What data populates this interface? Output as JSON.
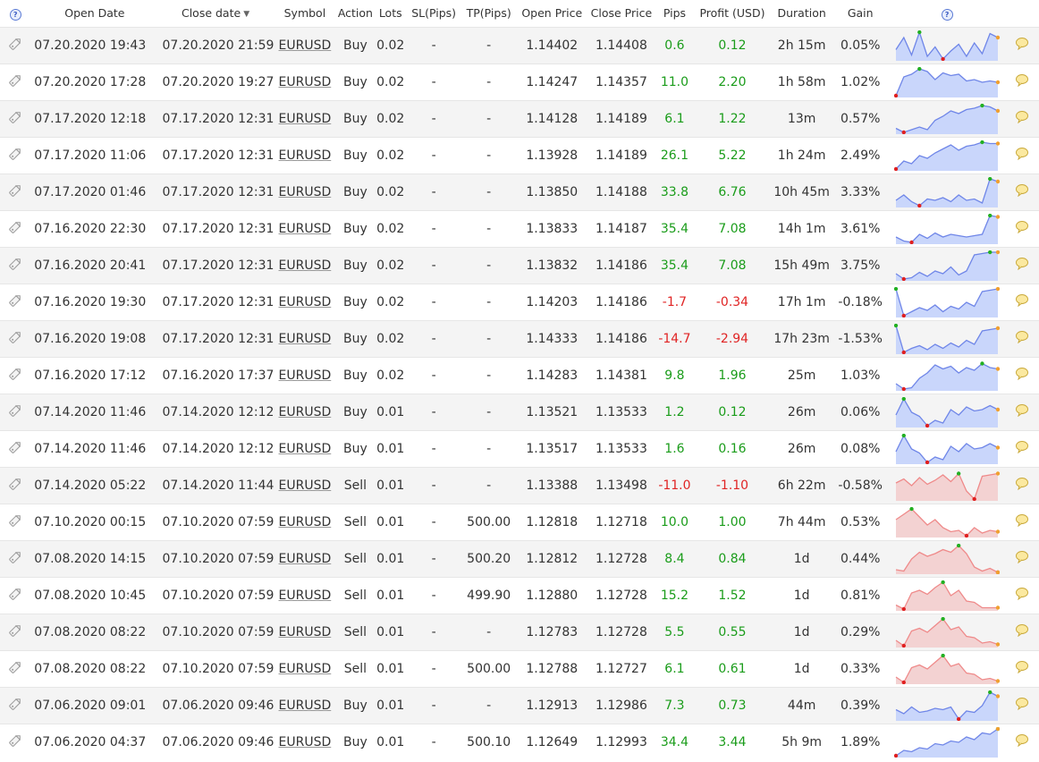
{
  "headers": {
    "open_date": "Open Date",
    "close_date": "Close date",
    "symbol": "Symbol",
    "action": "Action",
    "lots": "Lots",
    "sl": "SL(Pips)",
    "tp": "TP(Pips)",
    "open_price": "Open Price",
    "close_price": "Close Price",
    "pips": "Pips",
    "profit": "Profit (USD)",
    "duration": "Duration",
    "gain": "Gain",
    "help_glyph": "?"
  },
  "colors": {
    "positive": "#1a9c1a",
    "negative": "#e02424",
    "buy_fill": "#c9d6fb",
    "buy_line": "#6f86e8",
    "sell_fill": "#f3d2d2",
    "sell_line": "#ef8a8a"
  },
  "rows": [
    {
      "open": "07.20.2020 19:43",
      "close": "07.20.2020 21:59",
      "symbol": "EURUSD",
      "action": "Buy",
      "lots": "0.02",
      "sl": "-",
      "tp": "-",
      "open_price": "1.14402",
      "close_price": "1.14408",
      "pips": "0.6",
      "profit": "0.12",
      "duration": "2h 15m",
      "gain": "0.05%",
      "sign": "pos",
      "spark": [
        0.35,
        0.8,
        0.15,
        1.0,
        0.1,
        0.45,
        0.0,
        0.3,
        0.55,
        0.1,
        0.6,
        0.2,
        0.95,
        0.8
      ]
    },
    {
      "open": "07.20.2020 17:28",
      "close": "07.20.2020 19:27",
      "symbol": "EURUSD",
      "action": "Buy",
      "lots": "0.02",
      "sl": "-",
      "tp": "-",
      "open_price": "1.14247",
      "close_price": "1.14357",
      "pips": "11.0",
      "profit": "2.20",
      "duration": "1h 58m",
      "gain": "1.02%",
      "sign": "pos",
      "spark": [
        0.0,
        0.7,
        0.8,
        1.0,
        0.9,
        0.6,
        0.85,
        0.75,
        0.8,
        0.55,
        0.6,
        0.5,
        0.55,
        0.5
      ]
    },
    {
      "open": "07.17.2020 12:18",
      "close": "07.17.2020 12:31",
      "symbol": "EURUSD",
      "action": "Buy",
      "lots": "0.02",
      "sl": "-",
      "tp": "-",
      "open_price": "1.14128",
      "close_price": "1.14189",
      "pips": "6.1",
      "profit": "1.22",
      "duration": "13m",
      "gain": "0.57%",
      "sign": "pos",
      "spark": [
        0.15,
        0.0,
        0.1,
        0.2,
        0.1,
        0.45,
        0.6,
        0.8,
        0.7,
        0.85,
        0.9,
        1.0,
        0.95,
        0.8
      ]
    },
    {
      "open": "07.17.2020 11:06",
      "close": "07.17.2020 12:31",
      "symbol": "EURUSD",
      "action": "Buy",
      "lots": "0.02",
      "sl": "-",
      "tp": "-",
      "open_price": "1.13928",
      "close_price": "1.14189",
      "pips": "26.1",
      "profit": "5.22",
      "duration": "1h 24m",
      "gain": "2.49%",
      "sign": "pos",
      "spark": [
        0.0,
        0.3,
        0.2,
        0.5,
        0.4,
        0.6,
        0.75,
        0.9,
        0.7,
        0.85,
        0.9,
        1.0,
        0.95,
        0.95
      ]
    },
    {
      "open": "07.17.2020 01:46",
      "close": "07.17.2020 12:31",
      "symbol": "EURUSD",
      "action": "Buy",
      "lots": "0.02",
      "sl": "-",
      "tp": "-",
      "open_price": "1.13850",
      "close_price": "1.14188",
      "pips": "33.8",
      "profit": "6.76",
      "duration": "10h 45m",
      "gain": "3.33%",
      "sign": "pos",
      "spark": [
        0.2,
        0.4,
        0.15,
        0.0,
        0.25,
        0.2,
        0.3,
        0.15,
        0.4,
        0.2,
        0.25,
        0.1,
        1.0,
        0.9
      ]
    },
    {
      "open": "07.16.2020 22:30",
      "close": "07.17.2020 12:31",
      "symbol": "EURUSD",
      "action": "Buy",
      "lots": "0.02",
      "sl": "-",
      "tp": "-",
      "open_price": "1.13833",
      "close_price": "1.14187",
      "pips": "35.4",
      "profit": "7.08",
      "duration": "14h 1m",
      "gain": "3.61%",
      "sign": "pos",
      "spark": [
        0.2,
        0.05,
        0.0,
        0.3,
        0.15,
        0.35,
        0.2,
        0.3,
        0.25,
        0.2,
        0.25,
        0.3,
        1.0,
        0.95
      ]
    },
    {
      "open": "07.16.2020 20:41",
      "close": "07.17.2020 12:31",
      "symbol": "EURUSD",
      "action": "Buy",
      "lots": "0.02",
      "sl": "-",
      "tp": "-",
      "open_price": "1.13832",
      "close_price": "1.14186",
      "pips": "35.4",
      "profit": "7.08",
      "duration": "15h 49m",
      "gain": "3.75%",
      "sign": "pos",
      "spark": [
        0.2,
        0.0,
        0.05,
        0.25,
        0.1,
        0.3,
        0.2,
        0.45,
        0.15,
        0.3,
        0.9,
        0.95,
        1.0,
        1.0
      ]
    },
    {
      "open": "07.16.2020 19:30",
      "close": "07.17.2020 12:31",
      "symbol": "EURUSD",
      "action": "Buy",
      "lots": "0.02",
      "sl": "-",
      "tp": "-",
      "open_price": "1.14203",
      "close_price": "1.14186",
      "pips": "-1.7",
      "profit": "-0.34",
      "duration": "17h 1m",
      "gain": "-0.18%",
      "sign": "neg",
      "spark": [
        1.0,
        0.0,
        0.15,
        0.3,
        0.2,
        0.4,
        0.15,
        0.35,
        0.25,
        0.5,
        0.35,
        0.9,
        0.95,
        1.0
      ]
    },
    {
      "open": "07.16.2020 19:08",
      "close": "07.17.2020 12:31",
      "symbol": "EURUSD",
      "action": "Buy",
      "lots": "0.02",
      "sl": "-",
      "tp": "-",
      "open_price": "1.14333",
      "close_price": "1.14186",
      "pips": "-14.7",
      "profit": "-2.94",
      "duration": "17h 23m",
      "gain": "-1.53%",
      "sign": "neg",
      "spark": [
        1.0,
        0.0,
        0.15,
        0.25,
        0.1,
        0.3,
        0.15,
        0.35,
        0.2,
        0.45,
        0.3,
        0.8,
        0.85,
        0.9
      ]
    },
    {
      "open": "07.16.2020 17:12",
      "close": "07.16.2020 17:37",
      "symbol": "EURUSD",
      "action": "Buy",
      "lots": "0.02",
      "sl": "-",
      "tp": "-",
      "open_price": "1.14283",
      "close_price": "1.14381",
      "pips": "9.8",
      "profit": "1.96",
      "duration": "25m",
      "gain": "1.03%",
      "sign": "pos",
      "spark": [
        0.2,
        0.0,
        0.05,
        0.4,
        0.6,
        0.9,
        0.75,
        0.85,
        0.6,
        0.8,
        0.7,
        0.95,
        0.8,
        0.75
      ]
    },
    {
      "open": "07.14.2020 11:46",
      "close": "07.14.2020 12:12",
      "symbol": "EURUSD",
      "action": "Buy",
      "lots": "0.01",
      "sl": "-",
      "tp": "-",
      "open_price": "1.13521",
      "close_price": "1.13533",
      "pips": "1.2",
      "profit": "0.12",
      "duration": "26m",
      "gain": "0.06%",
      "sign": "pos",
      "spark": [
        0.4,
        1.0,
        0.5,
        0.35,
        0.0,
        0.2,
        0.1,
        0.6,
        0.4,
        0.7,
        0.55,
        0.6,
        0.75,
        0.6
      ]
    },
    {
      "open": "07.14.2020 11:46",
      "close": "07.14.2020 12:12",
      "symbol": "EURUSD",
      "action": "Buy",
      "lots": "0.01",
      "sl": "-",
      "tp": "-",
      "open_price": "1.13517",
      "close_price": "1.13533",
      "pips": "1.6",
      "profit": "0.16",
      "duration": "26m",
      "gain": "0.08%",
      "sign": "pos",
      "spark": [
        0.4,
        1.0,
        0.5,
        0.35,
        0.0,
        0.2,
        0.1,
        0.6,
        0.4,
        0.7,
        0.5,
        0.55,
        0.7,
        0.55
      ]
    },
    {
      "open": "07.14.2020 05:22",
      "close": "07.14.2020 11:44",
      "symbol": "EURUSD",
      "action": "Sell",
      "lots": "0.01",
      "sl": "-",
      "tp": "-",
      "open_price": "1.13388",
      "close_price": "1.13498",
      "pips": "-11.0",
      "profit": "-1.10",
      "duration": "6h 22m",
      "gain": "-0.58%",
      "sign": "neg",
      "spark": [
        0.6,
        0.75,
        0.5,
        0.8,
        0.55,
        0.7,
        0.9,
        0.65,
        0.95,
        0.3,
        0.0,
        0.85,
        0.9,
        0.95
      ]
    },
    {
      "open": "07.10.2020 00:15",
      "close": "07.10.2020 07:59",
      "symbol": "EURUSD",
      "action": "Sell",
      "lots": "0.01",
      "sl": "-",
      "tp": "500.00",
      "open_price": "1.12818",
      "close_price": "1.12718",
      "pips": "10.0",
      "profit": "1.00",
      "duration": "7h 44m",
      "gain": "0.53%",
      "sign": "pos",
      "spark": [
        0.6,
        0.8,
        1.0,
        0.7,
        0.4,
        0.6,
        0.3,
        0.15,
        0.2,
        0.0,
        0.3,
        0.1,
        0.2,
        0.15
      ]
    },
    {
      "open": "07.08.2020 14:15",
      "close": "07.10.2020 07:59",
      "symbol": "EURUSD",
      "action": "Sell",
      "lots": "0.01",
      "sl": "-",
      "tp": "500.20",
      "open_price": "1.12812",
      "close_price": "1.12728",
      "pips": "8.4",
      "profit": "0.84",
      "duration": "1d",
      "gain": "0.44%",
      "sign": "pos",
      "spark": [
        0.1,
        0.05,
        0.5,
        0.75,
        0.6,
        0.7,
        0.85,
        0.75,
        1.0,
        0.7,
        0.2,
        0.05,
        0.15,
        0.0
      ]
    },
    {
      "open": "07.08.2020 10:45",
      "close": "07.10.2020 07:59",
      "symbol": "EURUSD",
      "action": "Sell",
      "lots": "0.01",
      "sl": "-",
      "tp": "499.90",
      "open_price": "1.12880",
      "close_price": "1.12728",
      "pips": "15.2",
      "profit": "1.52",
      "duration": "1d",
      "gain": "0.81%",
      "sign": "pos",
      "spark": [
        0.15,
        0.0,
        0.6,
        0.7,
        0.55,
        0.8,
        1.0,
        0.5,
        0.7,
        0.3,
        0.25,
        0.05,
        0.05,
        0.05
      ]
    },
    {
      "open": "07.08.2020 08:22",
      "close": "07.10.2020 07:59",
      "symbol": "EURUSD",
      "action": "Sell",
      "lots": "0.01",
      "sl": "-",
      "tp": "-",
      "open_price": "1.12783",
      "close_price": "1.12728",
      "pips": "5.5",
      "profit": "0.55",
      "duration": "1d",
      "gain": "0.29%",
      "sign": "pos",
      "spark": [
        0.2,
        0.0,
        0.55,
        0.65,
        0.5,
        0.75,
        1.0,
        0.6,
        0.7,
        0.35,
        0.3,
        0.1,
        0.15,
        0.05
      ]
    },
    {
      "open": "07.08.2020 08:22",
      "close": "07.10.2020 07:59",
      "symbol": "EURUSD",
      "action": "Sell",
      "lots": "0.01",
      "sl": "-",
      "tp": "500.00",
      "open_price": "1.12788",
      "close_price": "1.12727",
      "pips": "6.1",
      "profit": "0.61",
      "duration": "1d",
      "gain": "0.33%",
      "sign": "pos",
      "spark": [
        0.2,
        0.0,
        0.55,
        0.65,
        0.5,
        0.75,
        1.0,
        0.6,
        0.7,
        0.35,
        0.3,
        0.1,
        0.15,
        0.05
      ]
    },
    {
      "open": "07.06.2020 09:01",
      "close": "07.06.2020 09:46",
      "symbol": "EURUSD",
      "action": "Buy",
      "lots": "0.01",
      "sl": "-",
      "tp": "-",
      "open_price": "1.12913",
      "close_price": "1.12986",
      "pips": "7.3",
      "profit": "0.73",
      "duration": "44m",
      "gain": "0.39%",
      "sign": "pos",
      "spark": [
        0.35,
        0.2,
        0.45,
        0.25,
        0.3,
        0.4,
        0.35,
        0.45,
        0.0,
        0.3,
        0.25,
        0.5,
        1.0,
        0.85
      ]
    },
    {
      "open": "07.06.2020 04:37",
      "close": "07.06.2020 09:46",
      "symbol": "EURUSD",
      "action": "Buy",
      "lots": "0.01",
      "sl": "-",
      "tp": "500.10",
      "open_price": "1.12649",
      "close_price": "1.12993",
      "pips": "34.4",
      "profit": "3.44",
      "duration": "5h 9m",
      "gain": "1.89%",
      "sign": "pos",
      "spark": [
        0.0,
        0.2,
        0.15,
        0.3,
        0.25,
        0.45,
        0.4,
        0.55,
        0.5,
        0.7,
        0.6,
        0.85,
        0.8,
        1.0
      ]
    }
  ]
}
